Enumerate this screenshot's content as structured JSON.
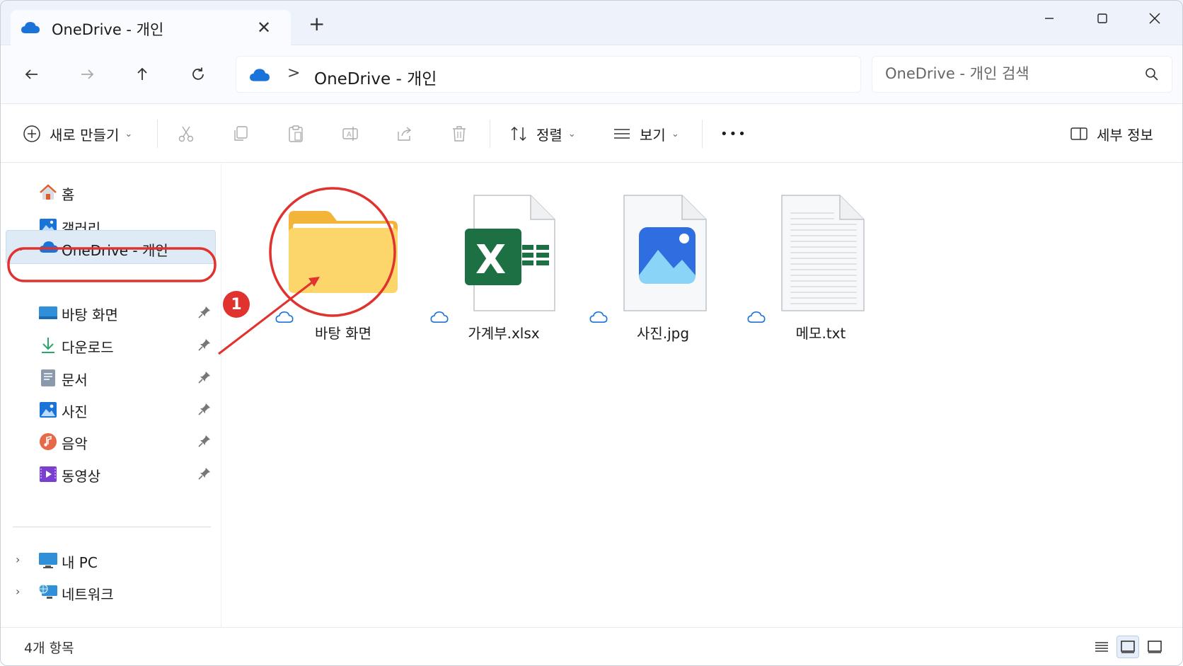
{
  "window": {
    "tab_title": "OneDrive - 개인",
    "new_tab_label": "+",
    "close_tab_label": "✕"
  },
  "address": {
    "separator": ">",
    "crumb": "OneDrive - 개인",
    "search_placeholder": "OneDrive - 개인 검색"
  },
  "toolbar": {
    "new_label": "새로 만들기",
    "sort_label": "정렬",
    "view_label": "보기",
    "more_label": "•••",
    "details_label": "세부 정보"
  },
  "sidebar": {
    "home": "홈",
    "gallery": "갤러리",
    "onedrive": "OneDrive - 개인",
    "quick_access": [
      {
        "label": "바탕 화면",
        "icon": "desktop-icon"
      },
      {
        "label": "다운로드",
        "icon": "download-icon"
      },
      {
        "label": "문서",
        "icon": "documents-icon"
      },
      {
        "label": "사진",
        "icon": "pictures-icon"
      },
      {
        "label": "음악",
        "icon": "music-icon"
      },
      {
        "label": "동영상",
        "icon": "videos-icon"
      }
    ],
    "this_pc": "내 PC",
    "network": "네트워크"
  },
  "files": [
    {
      "name": "바탕 화면",
      "type": "folder"
    },
    {
      "name": "가계부.xlsx",
      "type": "excel"
    },
    {
      "name": "사진.jpg",
      "type": "image"
    },
    {
      "name": "메모.txt",
      "type": "text"
    }
  ],
  "annotation": {
    "step": "1",
    "color": "#e0322f"
  },
  "status": {
    "item_count": "4개 항목"
  },
  "colors": {
    "accent": "#0f6cbd",
    "onedrive_blue": "#1a73d9",
    "selection": "#dfeaf7",
    "annotation_red": "#e0322f",
    "excel_green": "#1d7044",
    "folder_yellow": "#f7c948"
  }
}
